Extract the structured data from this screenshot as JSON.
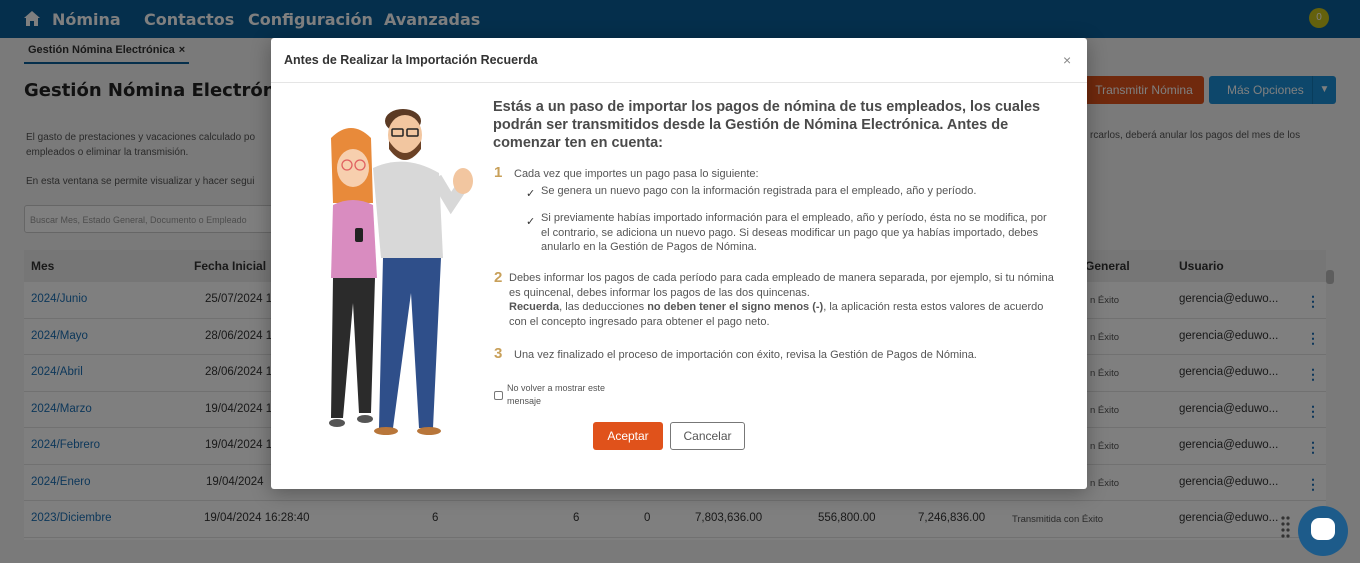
{
  "nav": {
    "home_label": "Nómina",
    "items": [
      "Contactos",
      "Configuración",
      "Avanzadas"
    ],
    "badge_count": "0"
  },
  "breadcrumb": {
    "tab_label": "Gestión Nómina Electrónica",
    "close": "×"
  },
  "page": {
    "title": "Gestión Nómina Electrónic",
    "transmit_button": "Transmitir Nómina",
    "more_button": "Más Opciones",
    "desc_line1": "El gasto de prestaciones y vacaciones calculado po",
    "desc_line2": "empleados o eliminar la transmisión.",
    "desc_right_line1": "rcarlos, deberá anular los pagos del mes de los",
    "desc_line3": "En esta ventana se permite visualizar y hacer segui",
    "search_placeholder": "Buscar Mes, Estado General, Documento o Empleado"
  },
  "table": {
    "headers": {
      "mes": "Mes",
      "fecha": "Fecha Inicial",
      "estado": "General",
      "usuario": "Usuario"
    },
    "rows": [
      {
        "mes": "2024/Junio",
        "fecha": "25/07/2024 1",
        "estado": "n Éxito",
        "usuario": "gerencia@eduwo..."
      },
      {
        "mes": "2024/Mayo",
        "fecha": "28/06/2024 1",
        "estado": "n Éxito",
        "usuario": "gerencia@eduwo..."
      },
      {
        "mes": "2024/Abril",
        "fecha": "28/06/2024 1",
        "estado": "n Éxito",
        "usuario": "gerencia@eduwo..."
      },
      {
        "mes": "2024/Marzo",
        "fecha": "19/04/2024 1",
        "estado": "n Éxito",
        "usuario": "gerencia@eduwo..."
      },
      {
        "mes": "2024/Febrero",
        "fecha": "19/04/2024 1",
        "estado": "n Éxito",
        "usuario": "gerencia@eduwo..."
      },
      {
        "mes": "2024/Enero",
        "fecha": "19/04/2024",
        "estado": "n Éxito",
        "usuario": "gerencia@eduwo..."
      },
      {
        "mes": "2023/Diciembre",
        "fecha": "19/04/2024 16:28:40",
        "c1": "6",
        "c2": "6",
        "c3": "0",
        "c4": "7,803,636.00",
        "c5": "556,800.00",
        "c6": "7,246,836.00",
        "estado": "Transmitida con Éxito",
        "usuario": "gerencia@eduwo..."
      }
    ]
  },
  "modal": {
    "title": "Antes de Realizar la Importación Recuerda",
    "close": "×",
    "lead": "Estás a un paso de importar los pagos de nómina de tus empleados, los cuales podrán ser transmitidos desde la Gestión de Nómina Electrónica. Antes de comenzar ten en cuenta:",
    "step1_num": "1",
    "step1_text": "Cada vez que importes un pago pasa lo siguiente:",
    "step1_check1": "Se genera un nuevo pago con la información registrada para el empleado, año y período.",
    "step1_check2": "Si previamente habías importado información para el empleado, año y período, ésta no se modifica, por el contrario, se adiciona un nuevo pago. Si deseas modificar un pago que ya habías importado, debes anularlo en la Gestión de Pagos de Nómina.",
    "step2_num": "2",
    "step2_text": "Debes informar los pagos de cada período para cada empleado de manera separada, por ejemplo, si tu nómina es quincenal, debes informar los pagos de las dos quincenas.",
    "step2_bold1": "Recuerda",
    "step2_mid": ", las deducciones ",
    "step2_bold2": "no deben tener el signo menos (-)",
    "step2_end": ", la aplicación resta estos valores de acuerdo con el concepto ingresado para obtener el pago neto.",
    "step3_num": "3",
    "step3_text": "Una vez finalizado el proceso de importación con éxito, revisa la Gestión de Pagos de Nómina.",
    "checkbox_label": "No volver a mostrar este mensaje",
    "accept": "Aceptar",
    "cancel": "Cancelar",
    "check_mark": "✓"
  },
  "colors": {
    "nav": "#0b5e99",
    "accent_orange": "#e0521b",
    "accent_blue": "#1a8fd6",
    "step_gold": "#c8a05a"
  }
}
